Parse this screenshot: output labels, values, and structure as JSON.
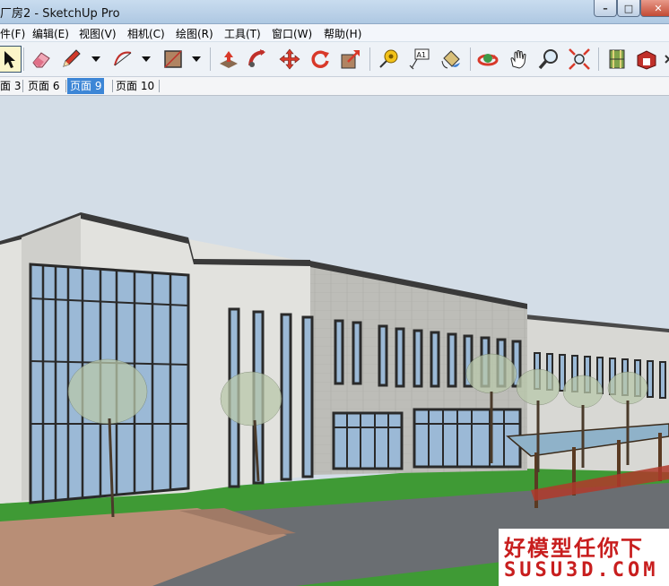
{
  "window": {
    "title": "厂房2 - SketchUp Pro",
    "controls": {
      "minimize": "–",
      "maximize": "□",
      "close": "✕"
    }
  },
  "menubar": [
    "件(F)",
    "编辑(E)",
    "视图(V)",
    "相机(C)",
    "绘图(R)",
    "工具(T)",
    "窗口(W)",
    "帮助(H)"
  ],
  "toolbar": [
    "select-icon",
    "eraser-icon",
    "pencil-line-icon",
    "arc-icon",
    "rectangle-icon",
    "push-pull-icon",
    "follow-me-icon",
    "move-icon",
    "rotate-icon",
    "scale-icon",
    "tape-measure-icon",
    "text-label-icon",
    "paint-bucket-icon",
    "orbit-icon",
    "pan-hand-icon",
    "zoom-icon",
    "zoom-extents-icon",
    "components-icon",
    "3d-warehouse-icon"
  ],
  "scene_tabs": [
    {
      "label": "面 3",
      "active": false
    },
    {
      "label": "页面 6",
      "active": false
    },
    {
      "label": "页面 9",
      "active": true
    },
    {
      "label": "页面 10",
      "active": false
    }
  ],
  "watermark": {
    "line1": "好模型任你下",
    "line2": "SUSU3D.COM"
  },
  "colors": {
    "sky": "#d3dde7",
    "grass": "#3f9a35",
    "road": "#6a6e72",
    "wall_light": "#e2e2de",
    "wall_stone": "#bdbdb8",
    "glass": "#9bb9d6",
    "window_frame": "#2a2a2a",
    "accent_tab": "#3d86d6",
    "watermark": "#c81e1e"
  }
}
